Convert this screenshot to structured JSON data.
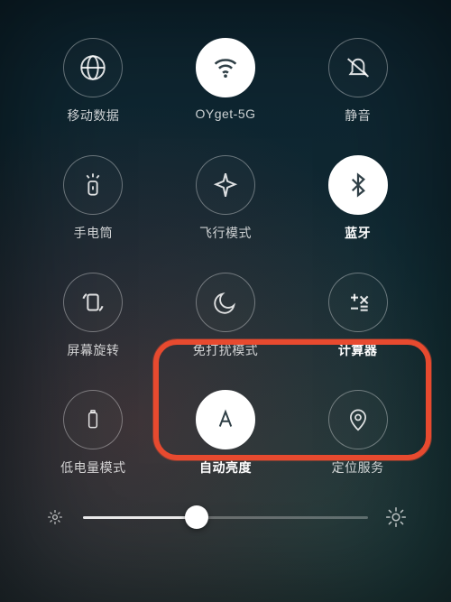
{
  "tiles": [
    {
      "id": "mobile-data",
      "label": "移动数据",
      "state": "off",
      "bold": false,
      "icon": "globe"
    },
    {
      "id": "wifi",
      "label": "OYget-5G",
      "state": "on",
      "bold": false,
      "icon": "wifi"
    },
    {
      "id": "mute",
      "label": "静音",
      "state": "off",
      "bold": false,
      "icon": "bell-off"
    },
    {
      "id": "flashlight",
      "label": "手电筒",
      "state": "off",
      "bold": false,
      "icon": "flashlight"
    },
    {
      "id": "airplane",
      "label": "飞行模式",
      "state": "off",
      "bold": false,
      "icon": "airplane"
    },
    {
      "id": "bluetooth",
      "label": "蓝牙",
      "state": "on",
      "bold": true,
      "icon": "bluetooth"
    },
    {
      "id": "rotation",
      "label": "屏幕旋转",
      "state": "off",
      "bold": false,
      "icon": "rotation"
    },
    {
      "id": "dnd",
      "label": "免打扰模式",
      "state": "off",
      "bold": false,
      "icon": "moon"
    },
    {
      "id": "calculator",
      "label": "计算器",
      "state": "off",
      "bold": true,
      "icon": "calculator"
    },
    {
      "id": "low-power",
      "label": "低电量模式",
      "state": "off",
      "bold": false,
      "icon": "battery"
    },
    {
      "id": "auto-brightness",
      "label": "自动亮度",
      "state": "on",
      "bold": true,
      "icon": "auto-bright"
    },
    {
      "id": "location",
      "label": "定位服务",
      "state": "off",
      "bold": false,
      "icon": "location"
    }
  ],
  "highlight": {
    "targets": [
      "auto-brightness",
      "location"
    ],
    "color": "#e74a2f"
  },
  "brightness": {
    "value": 40
  }
}
